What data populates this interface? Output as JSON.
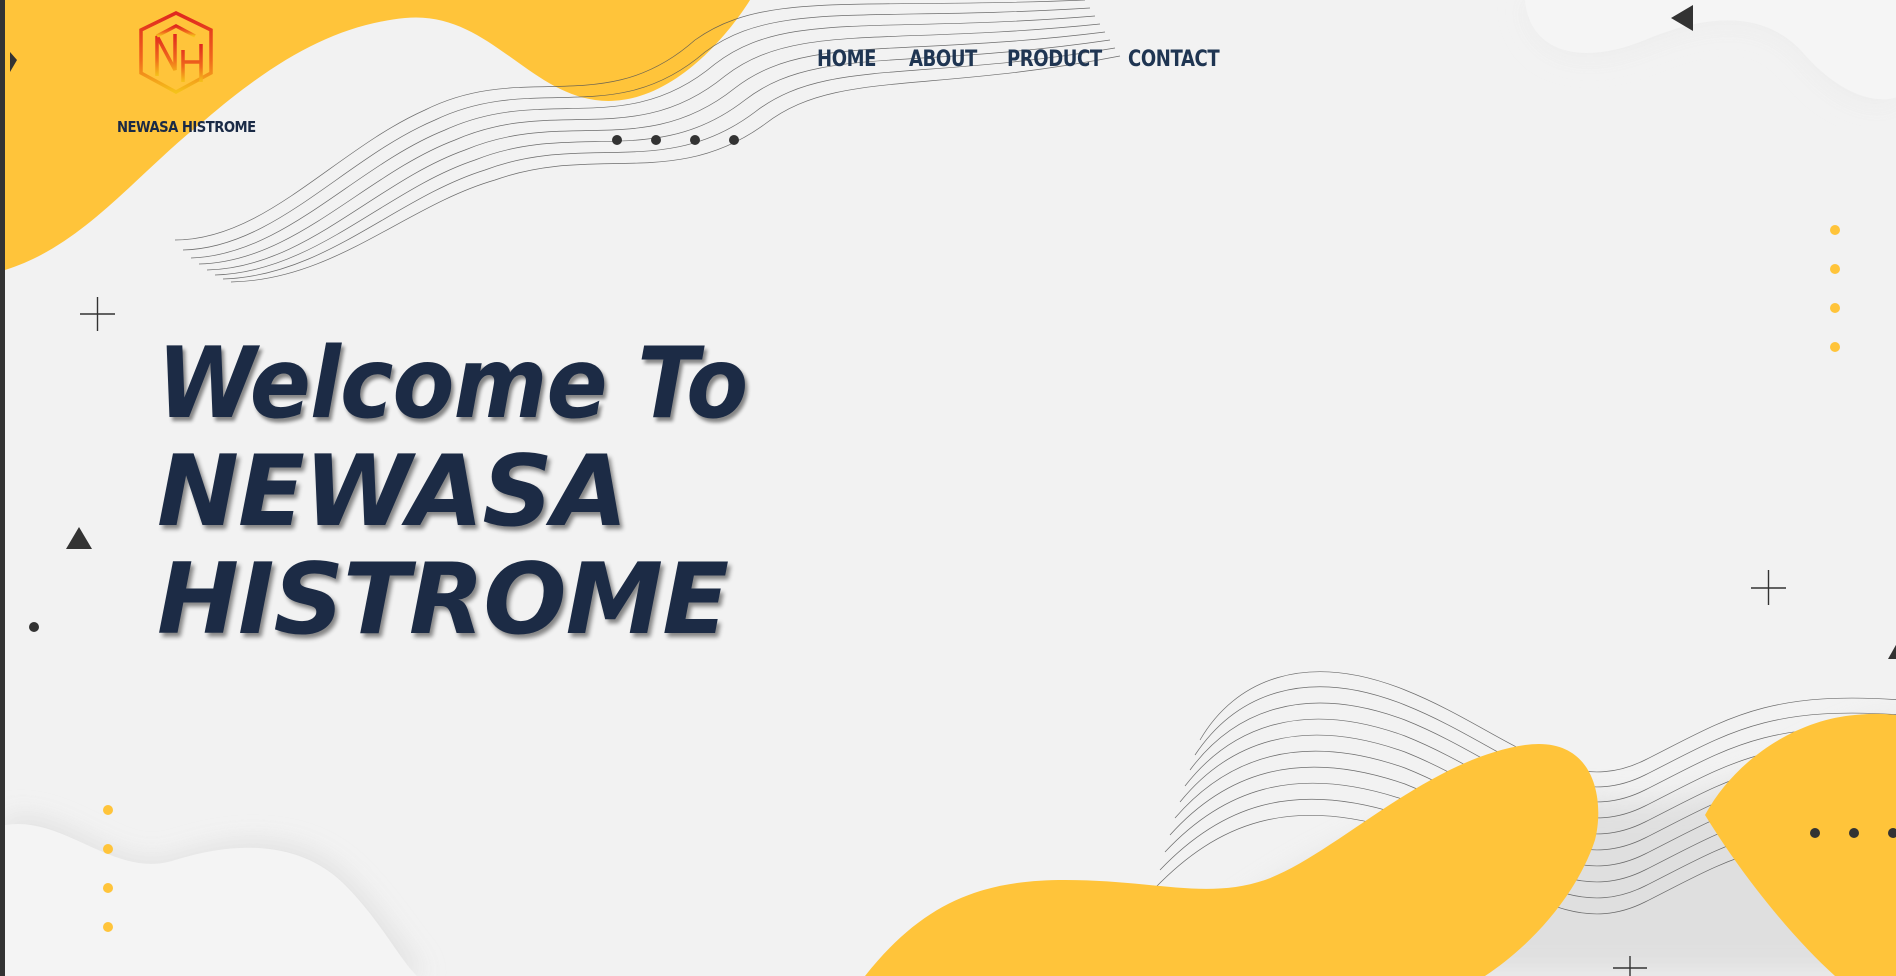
{
  "brand": {
    "name": "NEWASA HISTROME",
    "logo_letters": "NH",
    "colors": {
      "navy": "#1c2b45",
      "accent_yellow": "#ffc43a",
      "logo_red": "#e0261f",
      "logo_orange": "#f48c1a",
      "background": "#f2f2f2"
    }
  },
  "nav": {
    "items": [
      {
        "label": "HOME"
      },
      {
        "label": "ABOUT"
      },
      {
        "label": "PRODUCT"
      },
      {
        "label": "CONTACT"
      }
    ]
  },
  "hero": {
    "line_1": "Welcome To",
    "line_2": "NEWASA",
    "line_3": "HISTROME"
  },
  "decor": {
    "icons": [
      "wave-lines",
      "yellow-blob",
      "dot-row",
      "plus-mark",
      "triangle-mark"
    ]
  }
}
